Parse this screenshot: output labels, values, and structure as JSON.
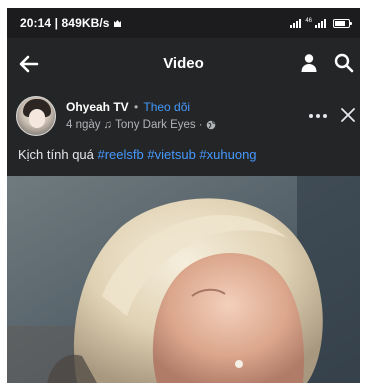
{
  "status_bar": {
    "time": "20:14 | 849KB/s",
    "battery_level": 0.8
  },
  "app_bar": {
    "title": "Video",
    "back_icon": "arrow-left-icon",
    "profile_icon": "person-icon",
    "search_icon": "search-icon"
  },
  "post": {
    "author": "Ohyeah TV",
    "separator": "•",
    "follow_label": "Theo dõi",
    "age": "4 ngày",
    "music_note": "♫",
    "music": "Tony Dark Eyes",
    "meta_dot": "·",
    "caption_text": "Kịch tính quá ",
    "hashtags": [
      "#reelsfb",
      "#vietsub",
      "#xuhuong"
    ],
    "more_icon": "more-horizontal-icon",
    "close_icon": "close-icon"
  },
  "colors": {
    "background": "#18191a",
    "surface": "#242526",
    "link": "#4599ff"
  }
}
